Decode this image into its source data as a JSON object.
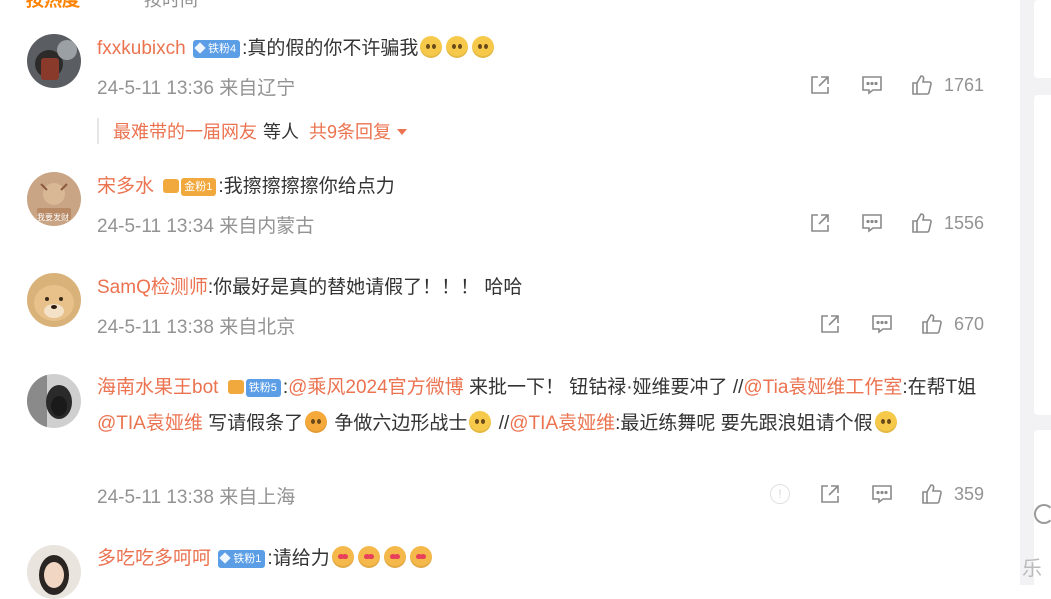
{
  "sort_bar": {
    "active": "按热度",
    "other": "按时间"
  },
  "colors": {
    "username": "#eb7350",
    "meta": "#939393",
    "badge_blue": "#5b9ee6",
    "badge_gold": "#f1a83d"
  },
  "comments": [
    {
      "username": "fxxkubixch",
      "badge": "铁粉4",
      "text": ":真的假的你不许骗我",
      "emojis": [
        "crying-emoji",
        "crying-emoji",
        "crying-emoji"
      ],
      "time": "24-5-11 13:36",
      "location": "来自辽宁",
      "likes": "1761",
      "replies": {
        "name": "最难带的一届网友",
        "mid": "等人",
        "count": "共9条回复"
      }
    },
    {
      "username": "宋多水",
      "badge": "金粉1",
      "text": ":我擦擦擦擦你给点力",
      "time": "24-5-11 13:34",
      "location": "来自内蒙古",
      "likes": "1556",
      "avatar_text": "我要发财"
    },
    {
      "username": "SamQ检测师",
      "text": ":你最好是真的替她请假了！！！ 哈哈",
      "time": "24-5-11 13:38",
      "location": "来自北京",
      "likes": "670"
    },
    {
      "username": "海南水果王bot",
      "badge": "铁粉5",
      "seg1": ":",
      "m1": "@乘风2024官方微博",
      "seg2": " 来批一下！ 钮钴禄·娅维要冲了 //",
      "m2": "@Tia袁娅维工作室",
      "seg3": ":在帮T姐",
      "m3": "@TIA袁娅维",
      "seg4": " 写请假条了",
      "seg5": " 争做六边形战士",
      "seg6": " //",
      "m4": "@TIA袁娅维",
      "seg7": ":最近练舞呢 要先跟浪姐请个假",
      "time": "24-5-11 13:38",
      "location": "来自上海",
      "likes": "359",
      "info": "!"
    },
    {
      "username": "多吃吃多呵呵",
      "badge": "铁粉1",
      "text": ":请给力",
      "emojis": [
        "heart-eyes-emoji",
        "heart-eyes-emoji",
        "heart-eyes-emoji",
        "heart-eyes-emoji"
      ]
    }
  ],
  "rail": {
    "char1": "乐"
  }
}
